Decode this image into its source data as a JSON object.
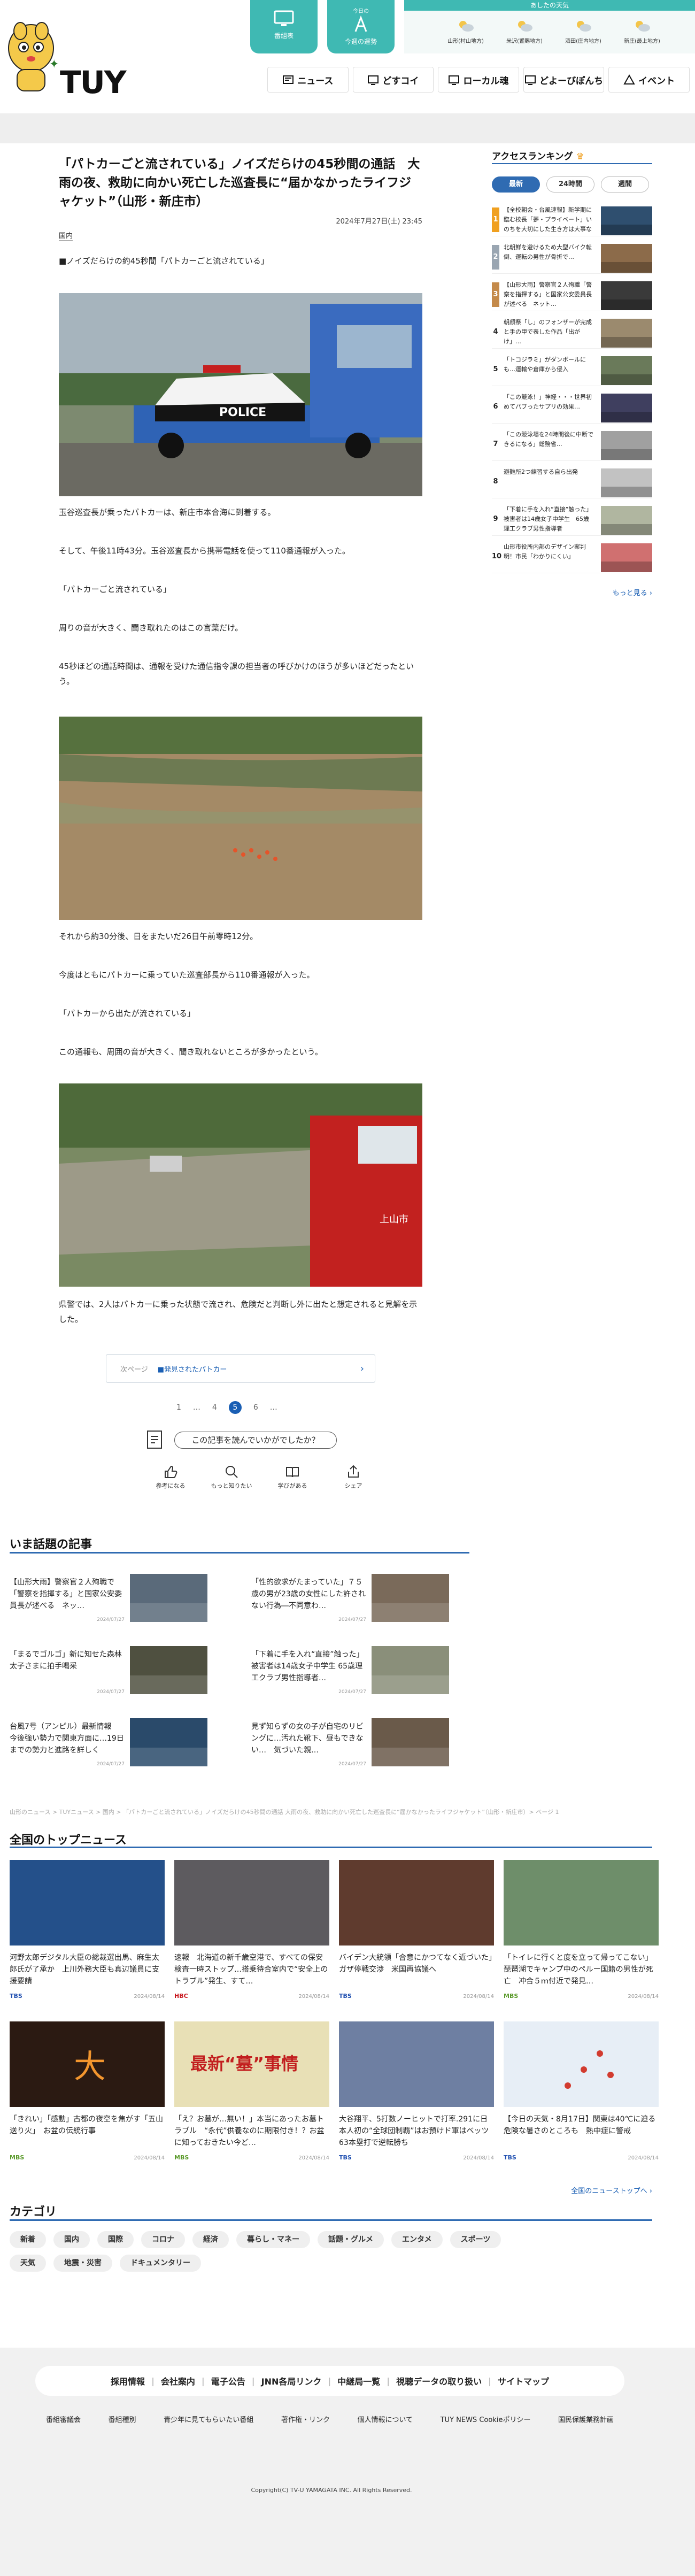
{
  "header": {
    "logo": "TUY",
    "top_buttons": [
      {
        "label": "番組表"
      },
      {
        "label": "今週の運勢",
        "sub": "今日の"
      }
    ],
    "weather": {
      "title": "あしたの天気",
      "cities": [
        {
          "name": "山形(村山地方)"
        },
        {
          "name": "米沢(置賜地方)"
        },
        {
          "name": "酒田(庄内地方)"
        },
        {
          "name": "新庄(最上地方)"
        }
      ]
    },
    "nav": [
      {
        "label": "ニュース"
      },
      {
        "label": "どすコイ"
      },
      {
        "label": "ローカル魂"
      },
      {
        "label": "どよーびぽんち"
      },
      {
        "label": "イベント"
      }
    ]
  },
  "article": {
    "title": "「パトカーごと流されている」ノイズだらけの45秒間の通話　大雨の夜、救助に向かい死亡した巡査長に“届かなかったライフジャケット”（山形・新庄市）",
    "date": "2024年7月27日(土) 23:45",
    "category": "国内",
    "lede": "■ノイズだらけの約45秒間「パトカーごと流されている」",
    "paragraphs": [
      "玉谷巡査長が乗ったパトカーは、新庄市本合海に到着する。",
      "そして、午後11時43分。玉谷巡査長から携帯電話を使って110番通報が入った。",
      "「パトカーごと流されている」",
      "周りの音が大きく、聞き取れたのはこの言葉だけ。",
      "45秒ほどの通話時間は、通報を受けた通信指令課の担当者の呼びかけのほうが多いほどだったという。",
      "それから約30分後、日をまたいだ26日午前零時12分。",
      "今度はともにパトカーに乗っていた巡査部長から110番通報が入った。",
      "「パトカーから出たが流されている」",
      "この通報も、周囲の音が大きく、聞き取れないところが多かったという。",
      "県警では、2人はパトカーに乗った状態で流され、危険だと判断し外に出たと想定されると見解を示した。"
    ],
    "police_label": "POLICE",
    "truck_label": "上山市",
    "next_link": {
      "tag": "次ページ",
      "text": "■発見されたパトカー"
    },
    "pager": [
      "1",
      "…",
      "4",
      "5",
      "6",
      "…"
    ],
    "reaction_question": "この記事を読んでいかがでしたか？",
    "reactions": [
      {
        "label": "参考になる"
      },
      {
        "label": "もっと知りたい"
      },
      {
        "label": "学びがある"
      },
      {
        "label": "シェア"
      }
    ]
  },
  "sidebar": {
    "title": "アクセスランキング",
    "tabs": [
      "最新",
      "24時間",
      "週間"
    ],
    "ranking": [
      {
        "rank": "1",
        "text": "【全校朝会・台風速報】新学期に臨む校長「夢・プライベート」いのちを大切にした生き方は大事なこととは"
      },
      {
        "rank": "2",
        "text": "北朝鮮を避けるため大型バイク転倒、運転の男性が骨折で…"
      },
      {
        "rank": "3",
        "text": "【山形大雨】警察官２人殉職「警察を指揮する」と国家公安委員長が述べる　ネット…"
      },
      {
        "rank": "4",
        "text": "朝顔祭「し」のフォンザーが完成と手の甲で表した作品「出がけ」…"
      },
      {
        "rank": "5",
        "text": "「トコジラミ」がダンボールにも…運輸や倉庫から侵入"
      },
      {
        "rank": "6",
        "text": "「この競泳！」神経・・・世界初めてパプったサプリの効果…"
      },
      {
        "rank": "7",
        "text": "「この競泳場を24時間後に中断できるになる」総務省…"
      },
      {
        "rank": "8",
        "text": "避難所2つ練習する自ら出発"
      },
      {
        "rank": "9",
        "text": "「下着に手を入れ“直接”触った」被害者は14歳女子中学生　65歳理工クラブ男性指導者"
      },
      {
        "rank": "10",
        "text": "山形市役所内部のデザイン案判明！市民「わかりにくい」"
      }
    ],
    "more": "もっと見る"
  },
  "topics": {
    "title": "いま話題の記事",
    "items": [
      {
        "text": "【山形大雨】警察官２人殉職で「警察を指揮する」と国家公安委員長が述べる　ネッ…",
        "date": "2024/07/27"
      },
      {
        "text": "「性的欲求がたまっていた」７５歳の男が23歳の女性にした許されない行為―不同意わ…",
        "date": "2024/07/27"
      },
      {
        "text": "「まるでゴルゴ」新に知せた森林太子さまに拍手喝采",
        "date": "2024/07/27"
      },
      {
        "text": "「下着に手を入れ“直接”触った」被害者は14歳女子中学生 65歳理工クラブ男性指導者…",
        "date": "2024/07/27"
      },
      {
        "text": "台風7号（アンピル）最新情報　今後強い勢力で関東方面に…19日までの勢力と進路を詳しく",
        "date": "2024/07/27"
      },
      {
        "text": "見ず知らずの女の子が自宅のリビングに…汚れた靴下、昼もできない…　気づいた親…",
        "date": "2024/07/27"
      }
    ]
  },
  "breadcrumb": "山形のニュース > TUYニュース > 国内 > 「パトカーごと流されている」ノイズだらけの45秒間の通話 大雨の夜、救助に向かい死亡した巡査長に“届かなかったライフジャケット”（山形・新庄市）> ページ 1",
  "top_news": {
    "title": "全国のトップニュース",
    "items": [
      {
        "text": "河野太郎デジタル大臣の総裁選出馬、麻生太郎氏が了承か　上川外務大臣も真辺議員に支援要請",
        "source": "TBS",
        "date": "2024/08/14",
        "color": "#1f4fb0"
      },
      {
        "text": "速報　北海道の新千歳空港で、すべての保安検査一時ストップ…搭乗待合室内で“安全上のトラブル”発生、すて…",
        "source": "HBC",
        "date": "2024/08/14",
        "color": "#c8161d"
      },
      {
        "text": "バイデン大統領「合意にかつてなく近づいた」ガザ停戦交渉　米国再協議へ",
        "source": "TBS",
        "date": "2024/08/14",
        "color": "#1f4fb0"
      },
      {
        "text": "「トイレに行くと度を立って帰ってこない」琵琶湖でキャンプ中のペルー国籍の男性が死亡　冲合５ｍ付近で発見…",
        "source": "MBS",
        "date": "2024/08/14",
        "color": "#5a9a2a"
      },
      {
        "text": "「きれい」「感動」古都の夜空を焦がす「五山送り火」　お盆の伝統行事",
        "source": "MBS",
        "date": "2024/08/14",
        "color": "#5a9a2a"
      },
      {
        "text": "「え？お墓が…無い！」本当にあったお墓トラブル　“永代”供養なのに期限付き！？お盆に知っておきたい今ど…",
        "source": "MBS",
        "date": "2024/08/14",
        "color": "#5a9a2a"
      },
      {
        "text": "大谷翔平、5打数ノーヒットで打率.291に日本人初の“全球団制覇”はお預けド軍はベッツ63本塁打で逆転勝ち",
        "source": "TBS",
        "date": "2024/08/14",
        "color": "#1f4fb0"
      },
      {
        "text": "【今日の天気・8月17日】関東は40℃に迫る危険な暑さのところも　熱中症に警戒",
        "source": "TBS",
        "date": "2024/08/14",
        "color": "#1f4fb0"
      }
    ],
    "more": "全国のニューストップへ",
    "thumb_texts": {
      "money": "最新“墓”事情",
      "fire": "大"
    }
  },
  "categories": {
    "title": "カテゴリ",
    "row1": [
      "新着",
      "国内",
      "国際",
      "コロナ",
      "経済",
      "暮らし・マネー",
      "話題・グルメ",
      "エンタメ",
      "スポーツ"
    ],
    "row2": [
      "天気",
      "地震・災害",
      "ドキュメンタリー"
    ]
  },
  "footer": {
    "links1": [
      "採用情報",
      "会社案内",
      "電子公告",
      "JNN各局リンク",
      "中継局一覧",
      "視聴データの取り扱い",
      "サイトマップ"
    ],
    "links2": [
      "番組審議会",
      "番組種別",
      "青少年に見てもらいたい番組",
      "著作権・リンク",
      "個人情報について",
      "TUY NEWS Cookieポリシー",
      "国民保護業務計画"
    ],
    "copyright": "Copyright(C) TV-U YAMAGATA INC. All Rights Reserved."
  },
  "colors": {
    "accent": "#3fb9b3",
    "link": "#1a5fb4",
    "rule": "#2f6bb2"
  }
}
